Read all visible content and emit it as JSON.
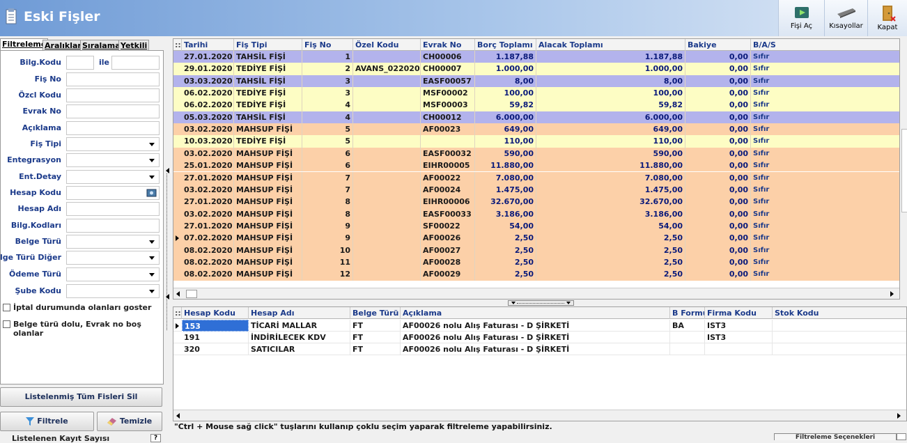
{
  "app": {
    "title": "Eski Fişler"
  },
  "toolbar": {
    "open_label": "Fişi Aç",
    "shortcuts_label": "Kısayollar",
    "close_label": "Kapat"
  },
  "left": {
    "tabs": [
      "Filtreleme",
      "Aralıklar",
      "Sıralama",
      "Yetkili"
    ],
    "fields": {
      "bilg_kodu": "Bilg.Kodu",
      "ile": "ile",
      "fis_no": "Fiş No",
      "ozel_kodu": "Özcl Kodu",
      "evrak_no": "Evrak No",
      "aciklama": "Açıklama",
      "fis_tipi": "Fiş Tipi",
      "entegrasyon": "Entegrasyon",
      "ent_detay": "Ent.Detay",
      "hesap_kodu": "Hesap Kodu",
      "hesap_adi": "Hesap Adı",
      "bilg_kodlari": "Bilg.Kodları",
      "belge_turu": "Belge Türü",
      "belge_turu_diger": "Belge Türü Diğer",
      "odeme_turu": "Ödeme Türü",
      "sube_kodu": "Şube Kodu"
    },
    "checkbox_iptal": "İptal durumunda olanları goster",
    "checkbox_belge": "Belge türü dolu, Evrak no boş olanlar",
    "delete_all_label": "Listelenmiş Tüm Fisleri Sil",
    "filter_label": "Filtrele",
    "clear_label": "Temizle",
    "count_label": "Listelenen Kayıt Sayısı"
  },
  "grid": {
    "columns": [
      "Tarihi",
      "Fiş Tipi",
      "Fiş No",
      "Özel Kodu",
      "Evrak No",
      "Borç Toplamı",
      "Alacak Toplamı",
      "Bakiye",
      "B/A/S"
    ],
    "colors": {
      "tahsil": "#b3b3ec",
      "tediye": "#fdfdc4",
      "mahsup": "#fcd0a8"
    },
    "rows": [
      {
        "date": "27.01.2020",
        "type": "TAHSİL FİŞİ",
        "no": "1",
        "ozel": "",
        "evrak": "CH00006",
        "borc": "1.187,88",
        "alacak": "1.187,88",
        "bakiye": "0,00",
        "bas": "Sıfır",
        "kind": "tahsil"
      },
      {
        "date": "29.01.2020",
        "type": "TEDİYE FİŞİ",
        "no": "2",
        "ozel": "AVANS_022020",
        "evrak": "CH00007",
        "borc": "1.000,00",
        "alacak": "1.000,00",
        "bakiye": "0,00",
        "bas": "Sıfır",
        "kind": "tediye"
      },
      {
        "date": "03.03.2020",
        "type": "TAHSİL FİŞİ",
        "no": "3",
        "ozel": "",
        "evrak": "EASF00057",
        "borc": "8,00",
        "alacak": "8,00",
        "bakiye": "0,00",
        "bas": "Sıfır",
        "kind": "tahsil"
      },
      {
        "date": "06.02.2020",
        "type": "TEDİYE FİŞİ",
        "no": "3",
        "ozel": "",
        "evrak": "MSF00002",
        "borc": "100,00",
        "alacak": "100,00",
        "bakiye": "0,00",
        "bas": "Sıfır",
        "kind": "tediye"
      },
      {
        "date": "06.02.2020",
        "type": "TEDİYE FİŞİ",
        "no": "4",
        "ozel": "",
        "evrak": "MSF00003",
        "borc": "59,82",
        "alacak": "59,82",
        "bakiye": "0,00",
        "bas": "Sıfır",
        "kind": "tediye"
      },
      {
        "date": "05.03.2020",
        "type": "TAHSİL FİŞİ",
        "no": "4",
        "ozel": "",
        "evrak": "CH00012",
        "borc": "6.000,00",
        "alacak": "6.000,00",
        "bakiye": "0,00",
        "bas": "Sıfır",
        "kind": "tahsil"
      },
      {
        "date": "03.02.2020",
        "type": "MAHSUP FİŞİ",
        "no": "5",
        "ozel": "",
        "evrak": "AF00023",
        "borc": "649,00",
        "alacak": "649,00",
        "bakiye": "0,00",
        "bas": "Sıfır",
        "kind": "mahsup"
      },
      {
        "date": "10.03.2020",
        "type": "TEDİYE FİŞİ",
        "no": "5",
        "ozel": "",
        "evrak": "",
        "borc": "110,00",
        "alacak": "110,00",
        "bakiye": "0,00",
        "bas": "Sıfır",
        "kind": "tediye"
      },
      {
        "date": "03.02.2020",
        "type": "MAHSUP FİŞİ",
        "no": "6",
        "ozel": "",
        "evrak": "EASF00032",
        "borc": "590,00",
        "alacak": "590,00",
        "bakiye": "0,00",
        "bas": "Sıfır",
        "kind": "mahsup"
      },
      {
        "date": "25.01.2020",
        "type": "MAHSUP FİŞİ",
        "no": "6",
        "ozel": "",
        "evrak": "EIHR00005",
        "borc": "11.880,00",
        "alacak": "11.880,00",
        "bakiye": "0,00",
        "bas": "Sıfır",
        "kind": "mahsup"
      },
      {
        "date": "27.01.2020",
        "type": "MAHSUP FİŞİ",
        "no": "7",
        "ozel": "",
        "evrak": "AF00022",
        "borc": "7.080,00",
        "alacak": "7.080,00",
        "bakiye": "0,00",
        "bas": "Sıfır",
        "kind": "mahsup"
      },
      {
        "date": "03.02.2020",
        "type": "MAHSUP FİŞİ",
        "no": "7",
        "ozel": "",
        "evrak": "AF00024",
        "borc": "1.475,00",
        "alacak": "1.475,00",
        "bakiye": "0,00",
        "bas": "Sıfır",
        "kind": "mahsup"
      },
      {
        "date": "27.01.2020",
        "type": "MAHSUP FİŞİ",
        "no": "8",
        "ozel": "",
        "evrak": "EIHR00006",
        "borc": "32.670,00",
        "alacak": "32.670,00",
        "bakiye": "0,00",
        "bas": "Sıfır",
        "kind": "mahsup"
      },
      {
        "date": "03.02.2020",
        "type": "MAHSUP FİŞİ",
        "no": "8",
        "ozel": "",
        "evrak": "EASF00033",
        "borc": "3.186,00",
        "alacak": "3.186,00",
        "bakiye": "0,00",
        "bas": "Sıfır",
        "kind": "mahsup"
      },
      {
        "date": "27.01.2020",
        "type": "MAHSUP FİŞİ",
        "no": "9",
        "ozel": "",
        "evrak": "SF00022",
        "borc": "54,00",
        "alacak": "54,00",
        "bakiye": "0,00",
        "bas": "Sıfır",
        "kind": "mahsup"
      },
      {
        "date": "07.02.2020",
        "type": "MAHSUP FİŞİ",
        "no": "9",
        "ozel": "",
        "evrak": "AF00026",
        "borc": "2,50",
        "alacak": "2,50",
        "bakiye": "0,00",
        "bas": "Sıfır",
        "kind": "mahsup"
      },
      {
        "date": "08.02.2020",
        "type": "MAHSUP FİŞİ",
        "no": "10",
        "ozel": "",
        "evrak": "AF00027",
        "borc": "2,50",
        "alacak": "2,50",
        "bakiye": "0,00",
        "bas": "Sıfır",
        "kind": "mahsup"
      },
      {
        "date": "08.02.2020",
        "type": "MAHSUP FİŞİ",
        "no": "11",
        "ozel": "",
        "evrak": "AF00028",
        "borc": "2,50",
        "alacak": "2,50",
        "bakiye": "0,00",
        "bas": "Sıfır",
        "kind": "mahsup"
      },
      {
        "date": "08.02.2020",
        "type": "MAHSUP FİŞİ",
        "no": "12",
        "ozel": "",
        "evrak": "AF00029",
        "borc": "2,50",
        "alacak": "2,50",
        "bakiye": "0,00",
        "bas": "Sıfır",
        "kind": "mahsup"
      }
    ]
  },
  "detail": {
    "columns": [
      "Hesap Kodu",
      "Hesap Adı",
      "Belge Türü",
      "Açıklama",
      "B Formu",
      "Firma Kodu",
      "Stok Kodu"
    ],
    "rows": [
      {
        "kod": "153",
        "ad": "TİCARİ MALLAR",
        "belge": "FT",
        "aciklama": "AF00026 nolu Alış Faturası - D ŞİRKETİ",
        "bform": "BA",
        "firma": "IST3",
        "stok": ""
      },
      {
        "kod": "191",
        "ad": "İNDİRİLECEK KDV",
        "belge": "FT",
        "aciklama": "AF00026 nolu Alış Faturası - D ŞİRKETİ",
        "bform": "",
        "firma": "IST3",
        "stok": ""
      },
      {
        "kod": "320",
        "ad": "SATICILAR",
        "belge": "FT",
        "aciklama": "AF00026 nolu Alış Faturası - D ŞİRKETİ",
        "bform": "",
        "firma": "",
        "stok": ""
      }
    ]
  },
  "hint": "\"Ctrl + Mouse sağ click\" tuşlarını kullanıp çoklu seçim yaparak filtreleme yapabilirsiniz.",
  "status": {
    "filter_options": "Filtreleme Seçenekleri"
  }
}
